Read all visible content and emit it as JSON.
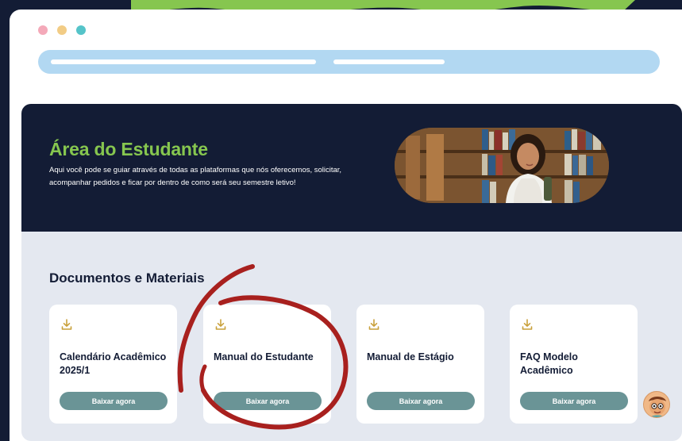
{
  "colors": {
    "background": "#131c35",
    "accent_green": "#86c64f",
    "address_bar": "#b2d8f2",
    "button": "#6a9496",
    "download_icon": "#c9a13c",
    "annotation_red": "#a8201e"
  },
  "window": {
    "dots": [
      "#f4a9b9",
      "#f2cc85",
      "#55c4c9"
    ]
  },
  "hero": {
    "title": "Área do Estudante",
    "description": "Aqui você pode se guiar através de todas as plataformas que nós oferecemos, solicitar, acompanhar pedidos e ficar por dentro de como será seu semestre letivo!"
  },
  "documents": {
    "heading": "Documentos e Materiais",
    "cards": [
      {
        "title": "Calendário Acadêmico 2025/1",
        "button": "Baixar agora",
        "icon": "download-icon"
      },
      {
        "title": "Manual do Estudante",
        "button": "Baixar agora",
        "icon": "download-icon"
      },
      {
        "title": "Manual de Estágio",
        "button": "Baixar agora",
        "icon": "download-icon"
      },
      {
        "title": "FAQ Modelo Acadêmico",
        "button": "Baixar agora",
        "icon": "download-icon"
      }
    ]
  }
}
